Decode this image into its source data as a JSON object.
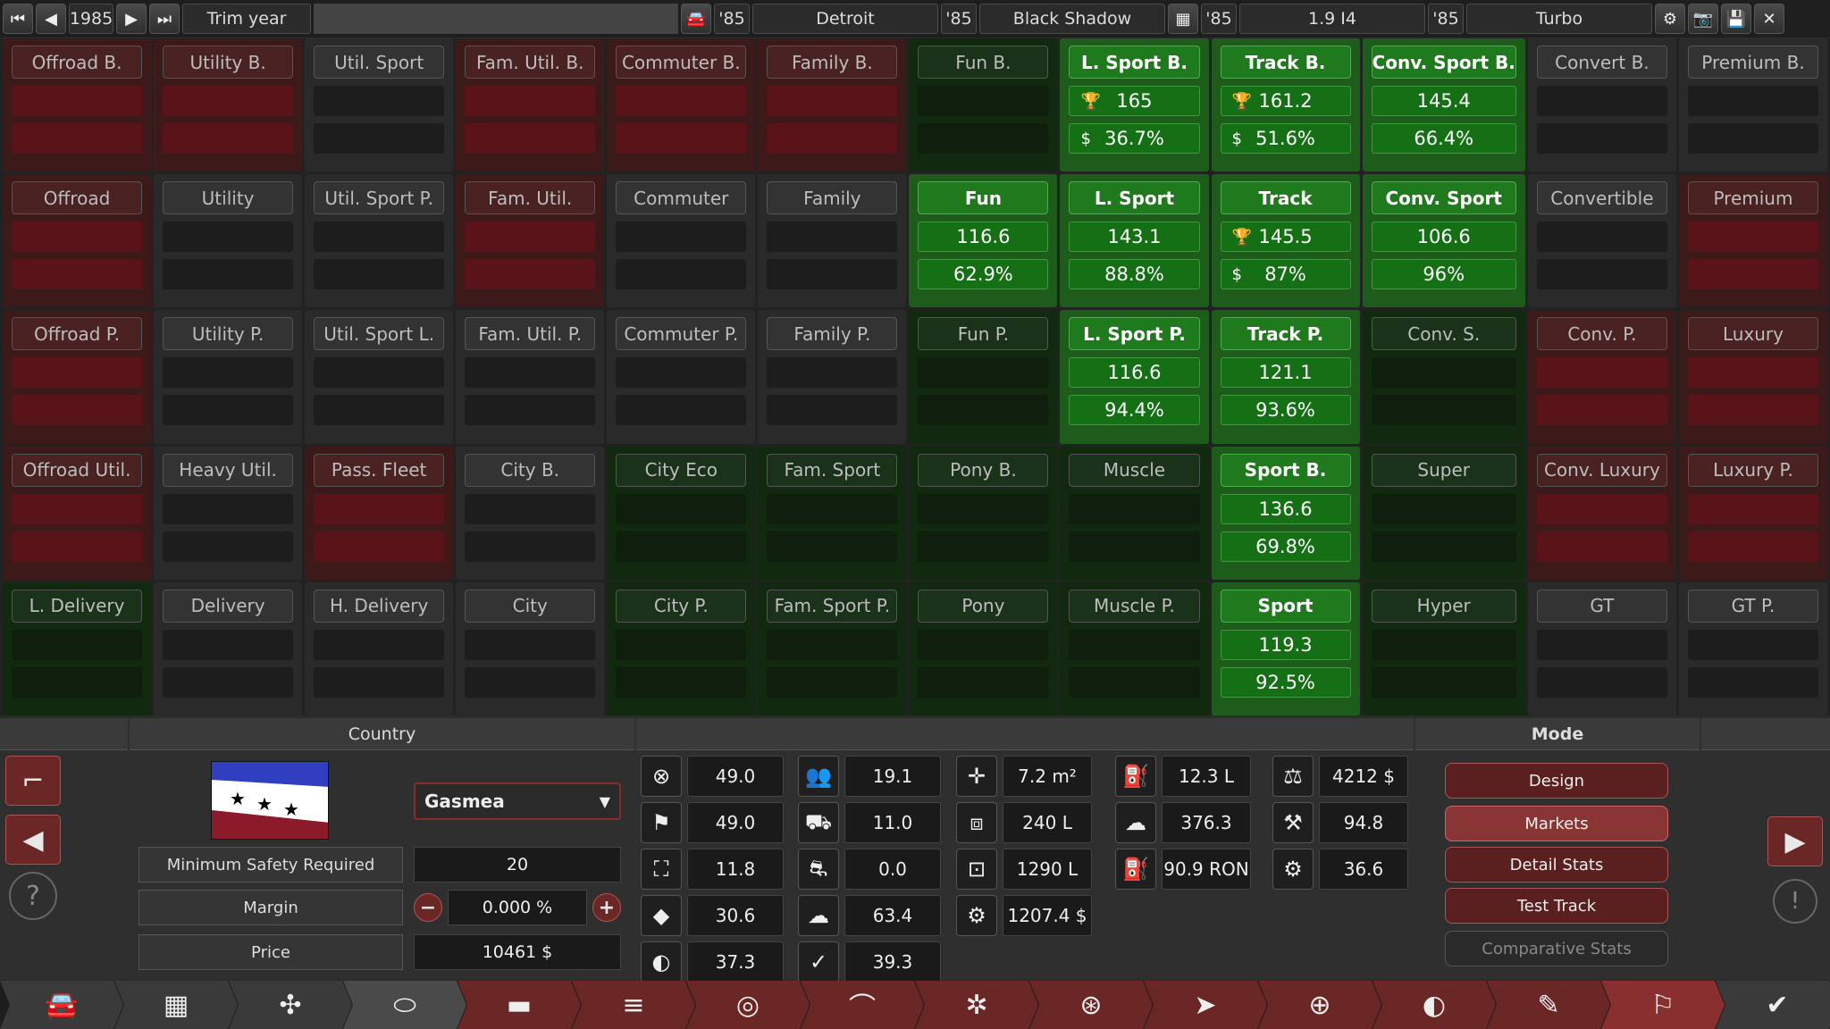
{
  "topbar": {
    "year": "1985",
    "trim_label": "Trim year",
    "car_year": "'85",
    "car_name": "Detroit",
    "trim_year": "'85",
    "trim_name": "Black Shadow",
    "engine_year": "'85",
    "engine_name": "1.9 I4",
    "engine_trim_year": "'85",
    "engine_trim_name": "Turbo"
  },
  "markets": [
    [
      {
        "n": "Offroad B.",
        "c": "red"
      },
      {
        "n": "Utility B.",
        "c": "red"
      },
      {
        "n": "Util. Sport",
        "c": "grey"
      },
      {
        "n": "Fam. Util. B.",
        "c": "red"
      },
      {
        "n": "Commuter B.",
        "c": "red"
      },
      {
        "n": "Family B.",
        "c": "red"
      },
      {
        "n": "Fun B.",
        "c": "dgreen"
      },
      {
        "n": "L. Sport B.",
        "c": "green",
        "v1": "165",
        "i1": "🏆",
        "v2": "36.7%",
        "i2": "$"
      },
      {
        "n": "Track B.",
        "c": "green",
        "v1": "161.2",
        "i1": "🏆",
        "v2": "51.6%",
        "i2": "$"
      },
      {
        "n": "Conv. Sport B.",
        "c": "green",
        "v1": "145.4",
        "v2": "66.4%"
      },
      {
        "n": "Convert B.",
        "c": "grey"
      },
      {
        "n": "Premium B.",
        "c": "grey"
      }
    ],
    [
      {
        "n": "Offroad",
        "c": "red"
      },
      {
        "n": "Utility",
        "c": "grey"
      },
      {
        "n": "Util. Sport P.",
        "c": "grey"
      },
      {
        "n": "Fam. Util.",
        "c": "red"
      },
      {
        "n": "Commuter",
        "c": "grey"
      },
      {
        "n": "Family",
        "c": "grey"
      },
      {
        "n": "Fun",
        "c": "green",
        "v1": "116.6",
        "v2": "62.9%"
      },
      {
        "n": "L. Sport",
        "c": "green",
        "v1": "143.1",
        "v2": "88.8%"
      },
      {
        "n": "Track",
        "c": "green",
        "v1": "145.5",
        "i1": "🏆",
        "v2": "87%",
        "i2": "$"
      },
      {
        "n": "Conv. Sport",
        "c": "green",
        "v1": "106.6",
        "v2": "96%"
      },
      {
        "n": "Convertible",
        "c": "grey"
      },
      {
        "n": "Premium",
        "c": "red"
      }
    ],
    [
      {
        "n": "Offroad P.",
        "c": "red"
      },
      {
        "n": "Utility P.",
        "c": "grey"
      },
      {
        "n": "Util. Sport L.",
        "c": "grey"
      },
      {
        "n": "Fam. Util. P.",
        "c": "grey"
      },
      {
        "n": "Commuter P.",
        "c": "grey"
      },
      {
        "n": "Family P.",
        "c": "grey"
      },
      {
        "n": "Fun P.",
        "c": "dgreen"
      },
      {
        "n": "L. Sport P.",
        "c": "green",
        "v1": "116.6",
        "v2": "94.4%"
      },
      {
        "n": "Track P.",
        "c": "green",
        "v1": "121.1",
        "v2": "93.6%"
      },
      {
        "n": "Conv. S.",
        "c": "dgreen"
      },
      {
        "n": "Conv. P.",
        "c": "red"
      },
      {
        "n": "Luxury",
        "c": "red"
      }
    ],
    [
      {
        "n": "Offroad Util.",
        "c": "red"
      },
      {
        "n": "Heavy Util.",
        "c": "grey"
      },
      {
        "n": "Pass. Fleet",
        "c": "red"
      },
      {
        "n": "City B.",
        "c": "grey"
      },
      {
        "n": "City Eco",
        "c": "dgreen"
      },
      {
        "n": "Fam. Sport",
        "c": "dgreen"
      },
      {
        "n": "Pony B.",
        "c": "dgreen"
      },
      {
        "n": "Muscle",
        "c": "dgreen"
      },
      {
        "n": "Sport B.",
        "c": "green",
        "v1": "136.6",
        "v2": "69.8%"
      },
      {
        "n": "Super",
        "c": "dgreen"
      },
      {
        "n": "Conv. Luxury",
        "c": "red"
      },
      {
        "n": "Luxury P.",
        "c": "red"
      }
    ],
    [
      {
        "n": "L. Delivery",
        "c": "dgreen"
      },
      {
        "n": "Delivery",
        "c": "grey"
      },
      {
        "n": "H. Delivery",
        "c": "grey"
      },
      {
        "n": "City",
        "c": "grey"
      },
      {
        "n": "City P.",
        "c": "dgreen"
      },
      {
        "n": "Fam. Sport P.",
        "c": "dgreen"
      },
      {
        "n": "Pony",
        "c": "dgreen"
      },
      {
        "n": "Muscle P.",
        "c": "dgreen"
      },
      {
        "n": "Sport",
        "c": "green",
        "v1": "119.3",
        "v2": "92.5%"
      },
      {
        "n": "Hyper",
        "c": "dgreen"
      },
      {
        "n": "GT",
        "c": "grey"
      },
      {
        "n": "GT P.",
        "c": "grey"
      }
    ]
  ],
  "country": {
    "header": "Country",
    "selected": "Gasmea",
    "min_safety_label": "Minimum Safety Required",
    "min_safety_value": "20",
    "margin_label": "Margin",
    "margin_value": "0.000 %",
    "price_label": "Price",
    "price_value": "10461 $"
  },
  "stats": [
    {
      "icon": "steering-wheel-icon",
      "g": "⊗",
      "v": "49.0"
    },
    {
      "icon": "checkered-flag-icon",
      "g": "⚑",
      "v": "49.0"
    },
    {
      "icon": "seat-icon",
      "g": "⛶",
      "v": "11.8"
    },
    {
      "icon": "diamond-icon",
      "g": "◆",
      "v": "30.6"
    },
    {
      "icon": "safety-icon",
      "g": "◐",
      "v": "37.3"
    },
    {
      "icon": "passengers-icon",
      "g": "👥",
      "v": "19.1"
    },
    {
      "icon": "truck-icon",
      "g": "⛟",
      "v": "11.0"
    },
    {
      "icon": "offroad-car-icon",
      "g": "⛐",
      "v": "0.0"
    },
    {
      "icon": "environment-icon",
      "g": "☁",
      "v": "63.4"
    },
    {
      "icon": "dependability-icon",
      "g": "✓",
      "v": "39.3"
    },
    {
      "icon": "move-arrows-icon",
      "g": "✛",
      "v": "7.2 m²"
    },
    {
      "icon": "cargo-volume-icon",
      "g": "⧈",
      "v": "240 L"
    },
    {
      "icon": "passenger-volume-icon",
      "g": "⊡",
      "v": "1290 L"
    },
    {
      "icon": "cost-wrench-icon",
      "g": "⚙",
      "v": "1207.4 $"
    },
    {
      "icon": "fuel-tank-icon",
      "g": "⛽",
      "v": "12.3 L"
    },
    {
      "icon": "emissions-cloud-icon",
      "g": "☁",
      "v": "376.3"
    },
    {
      "icon": "fuel-pump-icon",
      "g": "⛽",
      "v": "90.9 RON"
    },
    {
      "icon": "cost-person-icon",
      "g": "⚖",
      "v": "4212 $"
    },
    {
      "icon": "anvil-icon",
      "g": "⚒",
      "v": "94.8"
    },
    {
      "icon": "maintenance-icon",
      "g": "⚙",
      "v": "36.6"
    }
  ],
  "mode": {
    "header": "Mode",
    "buttons": [
      "Design",
      "Markets",
      "Detail Stats",
      "Test Track",
      "Comparative Stats"
    ]
  },
  "colors": {
    "market_red": "#3d1a1a",
    "market_green": "#1d5c1a",
    "market_dark_green": "#11290f",
    "mode_active": "#7a2b2b"
  }
}
